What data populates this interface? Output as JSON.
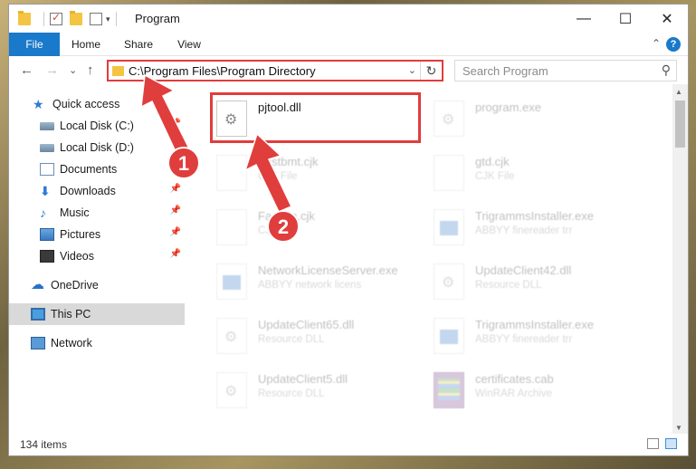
{
  "window": {
    "title": "Program",
    "minimize": "—",
    "maximize": "☐",
    "close": "✕"
  },
  "ribbon": {
    "tabs": [
      "File",
      "Home",
      "Share",
      "View"
    ],
    "help": "?"
  },
  "address": {
    "path": "C:\\Program Files\\Program Directory",
    "refresh": "↻",
    "dropdown": "⌄"
  },
  "search": {
    "placeholder": "Search Program",
    "icon": "⚲"
  },
  "nav_buttons": {
    "back": "←",
    "forward": "→",
    "dropdown": "⌄",
    "up": "↑"
  },
  "sidebar": {
    "items": [
      {
        "label": "Quick access",
        "icon": "star-icon"
      },
      {
        "label": "Local Disk (C:)",
        "icon": "disk-icon",
        "pinned": true
      },
      {
        "label": "Local Disk (D:)",
        "icon": "disk-icon"
      },
      {
        "label": "Documents",
        "icon": "documents-icon"
      },
      {
        "label": "Downloads",
        "icon": "downloads-icon",
        "pinned": true
      },
      {
        "label": "Music",
        "icon": "music-icon",
        "pinned": true
      },
      {
        "label": "Pictures",
        "icon": "pictures-icon",
        "pinned": true
      },
      {
        "label": "Videos",
        "icon": "videos-icon",
        "pinned": true
      },
      {
        "label": "OneDrive",
        "icon": "cloud-icon"
      },
      {
        "label": "This PC",
        "icon": "computer-icon",
        "selected": true
      },
      {
        "label": "Network",
        "icon": "network-icon"
      }
    ],
    "pin_glyph": "📌"
  },
  "files": [
    {
      "name": "pjtool.dll",
      "desc": "",
      "icon": "dll-icon",
      "highlighted": true
    },
    {
      "name": "program.exe",
      "desc": "",
      "icon": "exe-icon"
    },
    {
      "name": "Fastbmt.cjk",
      "desc": "CJK File",
      "icon": "file-icon"
    },
    {
      "name": "gtd.cjk",
      "desc": "CJK File",
      "icon": "file-icon"
    },
    {
      "name": "Fastbm.cjk",
      "desc": "CJK File",
      "icon": "file-icon"
    },
    {
      "name": "TrigrammsInstaller.exe",
      "desc": "ABBYY finereader trr",
      "icon": "exe-icon"
    },
    {
      "name": "NetworkLicenseServer.exe",
      "desc": "ABBYY network licens",
      "icon": "exe-icon"
    },
    {
      "name": "UpdateClient42.dll",
      "desc": "Resource DLL",
      "icon": "dll-icon"
    },
    {
      "name": "UpdateClient65.dll",
      "desc": "Resource DLL",
      "icon": "dll-icon"
    },
    {
      "name": "TrigrammsInstaller.exe",
      "desc": "ABBYY finereader trr",
      "icon": "exe-icon"
    },
    {
      "name": "UpdateClient5.dll",
      "desc": "Resource DLL",
      "icon": "dll-icon"
    },
    {
      "name": "certificates.cab",
      "desc": "WinRAR Archive",
      "icon": "archive-icon"
    }
  ],
  "status": {
    "item_count": "134 items"
  },
  "annotations": {
    "step1": "1",
    "step2": "2",
    "color": "#e03d3d"
  }
}
